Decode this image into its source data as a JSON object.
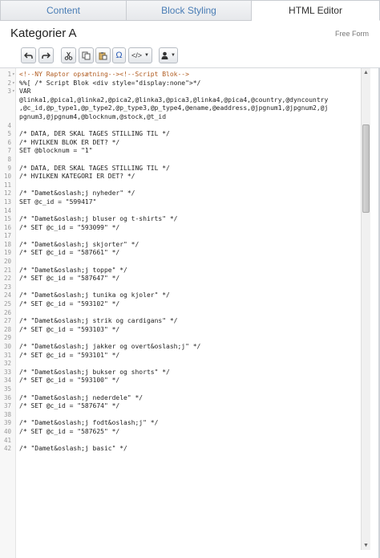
{
  "tabs": [
    {
      "label": "Content",
      "active": false
    },
    {
      "label": "Block Styling",
      "active": false
    },
    {
      "label": "HTML Editor",
      "active": true
    }
  ],
  "page": {
    "title": "Kategorier A",
    "form_type": "Free Form"
  },
  "toolbar": {
    "buttons": [
      {
        "name": "undo-button",
        "icon": "undo-icon"
      },
      {
        "name": "redo-button",
        "icon": "redo-icon"
      },
      {
        "name": "cut-button",
        "icon": "scissors-icon"
      },
      {
        "name": "copy-button",
        "icon": "copy-icon"
      },
      {
        "name": "paste-button",
        "icon": "paste-icon"
      },
      {
        "name": "special-char-button",
        "icon": "omega-icon",
        "label": "Ω"
      },
      {
        "name": "code-dropdown-button",
        "icon": "code-icon",
        "label": "</>"
      },
      {
        "name": "user-dropdown-button",
        "icon": "user-icon"
      }
    ],
    "omega_label": "Ω",
    "code_label": "</>"
  },
  "editor": {
    "lines": [
      {
        "n": "1",
        "text": "<!--NY Raptor opsætning--><!--Script Blok-->"
      },
      {
        "n": "2",
        "text": "%%[ /* Script Blok <div style=\"display:none\">*/"
      },
      {
        "n": "3",
        "text": "VAR"
      },
      {
        "n": "",
        "text": "@linka1,@pica1,@linka2,@pica2,@linka3,@pica3,@linka4,@pica4,@country,@dyncountry"
      },
      {
        "n": "",
        "text": ",@c_id,@p_type1,@p_type2,@p_type3,@p_type4,@ename,@eaddress,@jpgnum1,@jpgnum2,@j"
      },
      {
        "n": "",
        "text": "pgnum3,@jpgnum4,@blocknum,@stock,@t_id"
      },
      {
        "n": "4",
        "text": ""
      },
      {
        "n": "5",
        "text": "/* DATA, DER SKAL TAGES STILLING TIL */"
      },
      {
        "n": "6",
        "text": "/* HVILKEN BLOK ER DET? */"
      },
      {
        "n": "7",
        "text": "SET @blocknum = \"1\""
      },
      {
        "n": "8",
        "text": ""
      },
      {
        "n": "9",
        "text": "/* DATA, DER SKAL TAGES STILLING TIL */"
      },
      {
        "n": "10",
        "text": "/* HVILKEN KATEGORI ER DET? */"
      },
      {
        "n": "11",
        "text": ""
      },
      {
        "n": "12",
        "text": "/* \"Damet&oslash;j nyheder\" */"
      },
      {
        "n": "13",
        "text": "SET @c_id = \"599417\""
      },
      {
        "n": "14",
        "text": ""
      },
      {
        "n": "15",
        "text": "/* \"Damet&oslash;j bluser og t-shirts\" */"
      },
      {
        "n": "16",
        "text": "/* SET @c_id = \"593099\" */"
      },
      {
        "n": "17",
        "text": ""
      },
      {
        "n": "18",
        "text": "/* \"Damet&oslash;j skjorter\" */"
      },
      {
        "n": "19",
        "text": "/* SET @c_id = \"587661\" */"
      },
      {
        "n": "20",
        "text": ""
      },
      {
        "n": "21",
        "text": "/* \"Damet&oslash;j toppe\" */"
      },
      {
        "n": "22",
        "text": "/* SET @c_id = \"587647\" */"
      },
      {
        "n": "23",
        "text": ""
      },
      {
        "n": "24",
        "text": "/* \"Damet&oslash;j tunika og kjoler\" */"
      },
      {
        "n": "25",
        "text": "/* SET @c_id = \"593102\" */"
      },
      {
        "n": "26",
        "text": ""
      },
      {
        "n": "27",
        "text": "/* \"Damet&oslash;j strik og cardigans\" */"
      },
      {
        "n": "28",
        "text": "/* SET @c_id = \"593103\" */"
      },
      {
        "n": "29",
        "text": ""
      },
      {
        "n": "30",
        "text": "/* \"Damet&oslash;j jakker og overt&oslash;j\" */"
      },
      {
        "n": "31",
        "text": "/* SET @c_id = \"593101\" */"
      },
      {
        "n": "32",
        "text": ""
      },
      {
        "n": "33",
        "text": "/* \"Damet&oslash;j bukser og shorts\" */"
      },
      {
        "n": "34",
        "text": "/* SET @c_id = \"593100\" */"
      },
      {
        "n": "35",
        "text": ""
      },
      {
        "n": "36",
        "text": "/* \"Damet&oslash;j nederdele\" */"
      },
      {
        "n": "37",
        "text": "/* SET @c_id = \"587674\" */"
      },
      {
        "n": "38",
        "text": ""
      },
      {
        "n": "39",
        "text": "/* \"Damet&oslash;j fodt&oslash;j\" */"
      },
      {
        "n": "40",
        "text": "/* SET @c_id = \"587625\" */"
      },
      {
        "n": "41",
        "text": ""
      },
      {
        "n": "42",
        "text": "/* \"Damet&oslash;j basic\" */"
      }
    ]
  },
  "colors": {
    "comment": "#b05a1e",
    "tag": "#2c5db7",
    "string": "#b03a3a",
    "tab_text": "#4a7db5"
  }
}
